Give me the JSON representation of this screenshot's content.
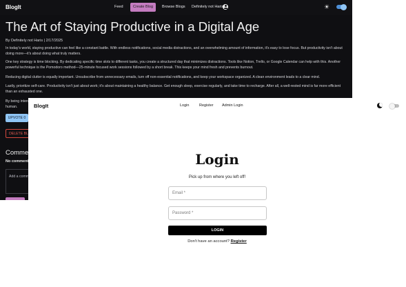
{
  "back_window": {
    "nav": {
      "brand": "BlogIt",
      "feed": "Feed",
      "create_blog": "Create Blog",
      "browse_blogs": "Browse Blogs",
      "user_name": "Definitely not Haris"
    },
    "post": {
      "title": "The Art of Staying Productive in a Digital Age",
      "meta": "By Definitely not Haris | 2/17/2025",
      "paragraphs": [
        "In today's world, staying productive can feel like a constant battle. With endless notifications, social media distractions, and an overwhelming amount of information, it's easy to lose focus. But productivity isn't about doing more—it's about doing what truly matters.",
        "One key strategy is time blocking. By dedicating specific time slots to different tasks, you create a structured day that minimizes distractions. Tools like Notion, Trello, or Google Calendar can help with this. Another powerful technique is the Pomodoro method—25-minute focused work sessions followed by a short break. This keeps your mind fresh and prevents burnout.",
        "Reducing digital clutter is equally important. Unsubscribe from unnecessary emails, turn off non-essential notifications, and keep your workspace organized. A clean environment leads to a clear mind.",
        "Lastly, prioritize self-care. Productivity isn't just about work; it's about maintaining a healthy balance. Get enough sleep, exercise regularly, and take time to recharge. After all, a well-rested mind is far more efficient than an exhausted one.",
        "By being inten",
        "human."
      ],
      "upvote_label": "UPVOTE 0",
      "delete_label": "DELETE BLO"
    },
    "comments": {
      "heading": "Comments",
      "empty_text": "No comments",
      "add_placeholder": "Add a comm"
    }
  },
  "front_window": {
    "nav": {
      "brand": "BlogIt",
      "login": "Login",
      "register": "Register",
      "admin_login": "Admin Login"
    },
    "form": {
      "title": "Login",
      "subtitle": "Pick up from where you left off!",
      "email_placeholder": "Email *",
      "password_placeholder": "Password *",
      "submit_label": "LOGIN",
      "footer_text": "Don't have an account?",
      "register_link": "Register"
    }
  },
  "colors": {
    "dark_bg": "#0f0f12",
    "accent_purple": "#c47cc0",
    "accent_blue": "#90c6f6",
    "danger_red": "#d5483e"
  },
  "icons": [
    "user-icon",
    "sun-icon",
    "moon-icon",
    "theme-toggle"
  ]
}
